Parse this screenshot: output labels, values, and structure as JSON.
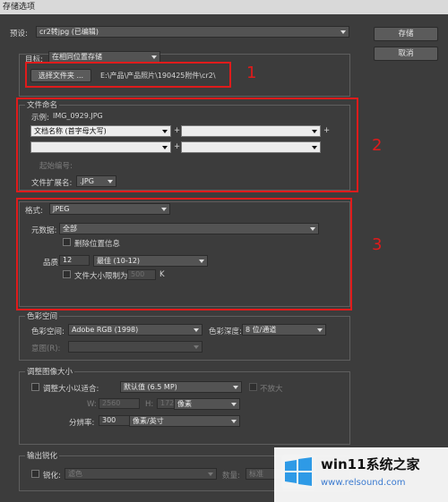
{
  "window": {
    "title": "存储选项"
  },
  "preset": {
    "label": "预设:",
    "value": "cr2转jpg (已编辑)"
  },
  "buttons": {
    "save": "存储",
    "cancel": "取消"
  },
  "destination": {
    "label": "目标:",
    "value": "在相同位置存储",
    "choose_folder": "选择文件夹 ...",
    "path": "E:\\产品\\产品照片\\190425附件\\cr2\\"
  },
  "file_naming": {
    "group_label": "文件命名",
    "example_label": "示例:",
    "example_value": "IMG_0929.JPG",
    "field1": "文档名称 (首字母大写)",
    "plus": "+",
    "start_number_label": "起始编号:",
    "extension_label": "文件扩展名:",
    "extension_value": ".JPG"
  },
  "format": {
    "label": "格式:",
    "value": "JPEG",
    "metadata_label": "元数据:",
    "metadata_value": "全部",
    "remove_location": "删除位置信息",
    "quality_label": "品质:",
    "quality_value": "12",
    "quality_preset": "最佳 (10-12)",
    "limit_size": "文件大小限制为:",
    "limit_value": "500",
    "limit_unit": "K"
  },
  "color_space": {
    "group_label": "色彩空间",
    "space_label": "色彩空间:",
    "space_value": "Adobe RGB (1998)",
    "depth_label": "色彩深度:",
    "depth_value": "8 位/通道",
    "intent_label": "意图(R):"
  },
  "resize": {
    "group_label": "调整图像大小",
    "fit_label": "调整大小以适合:",
    "fit_value": "默认值 (6.5 MP)",
    "no_enlarge": "不放大",
    "w_label": "W:",
    "w_value": "2560",
    "h_label": "H:",
    "h_value": "1720",
    "unit_value": "像素",
    "resolution_label": "分辨率:",
    "resolution_value": "300",
    "resolution_unit": "像素/英寸"
  },
  "sharpen": {
    "group_label": "输出锐化",
    "sharpen_label": "锐化:",
    "sharpen_value": "滤色",
    "amount_label": "数量:",
    "amount_value": "标准"
  },
  "annotations": {
    "n1": "1",
    "n2": "2",
    "n3": "3"
  },
  "watermark": {
    "title": "win11系统之家",
    "url": "www.relsound.com"
  },
  "colors": {
    "annotation_red": "#e01b1b",
    "dialog_bg": "#3c3c3c"
  }
}
